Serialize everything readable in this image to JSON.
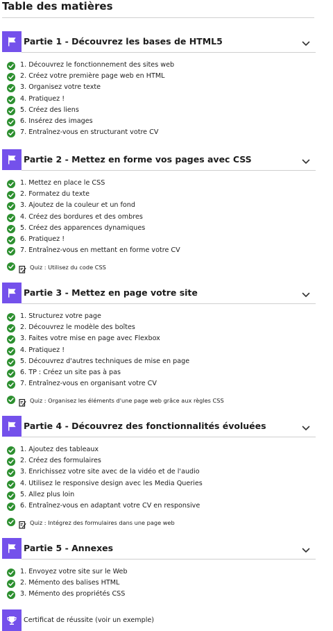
{
  "toc": {
    "title": "Table des matières"
  },
  "parts": [
    {
      "number": "Partie 1",
      "separator": " - ",
      "name": "Découvrez les bases de HTML5",
      "chapters": [
        "1. Découvrez le fonctionnement des sites web",
        "2. Créez votre première page web en HTML",
        "3. Organisez votre texte",
        "4. Pratiquez !",
        "5. Créez des liens",
        "6. Insérez des images",
        "7. Entraînez-vous en structurant votre CV"
      ],
      "quiz": null
    },
    {
      "number": "Partie 2",
      "separator": " - ",
      "name": "Mettez en forme vos pages avec CSS",
      "chapters": [
        "1. Mettez en place le CSS",
        "2. Formatez du texte",
        "3. Ajoutez de la couleur et un fond",
        "4. Créez des bordures et des ombres",
        "5. Créez des apparences dynamiques",
        "6. Pratiquez !",
        "7. Entraînez-vous en mettant en forme votre CV"
      ],
      "quiz": "Quiz : Utilisez du code CSS"
    },
    {
      "number": "Partie 3",
      "separator": " - ",
      "name": "Mettez en page votre site",
      "chapters": [
        "1. Structurez votre page",
        "2. Découvrez le modèle des boîtes",
        "3. Faites votre mise en page avec Flexbox",
        "4. Pratiquez !",
        "5. Découvrez d'autres techniques de mise en page",
        "6. TP : Créez un site pas à pas",
        "7. Entraînez-vous en organisant votre CV"
      ],
      "quiz": "Quiz : Organisez les éléments d'une page web grâce aux règles CSS"
    },
    {
      "number": "Partie 4",
      "separator": " - ",
      "name": "Découvrez des fonctionnalités évoluées",
      "chapters": [
        "1. Ajoutez des tableaux",
        "2. Créez des formulaires",
        "3. Enrichissez votre site avec de la vidéo et de l'audio",
        "4. Utilisez le responsive design avec les Media Queries",
        "5. Allez plus loin",
        "6. Entraînez-vous en adaptant votre CV en responsive"
      ],
      "quiz": "Quiz : Intégrez des formulaires dans une page web"
    },
    {
      "number": "Partie 5",
      "separator": " - ",
      "name": "Annexes",
      "chapters": [
        "1. Envoyez votre site sur le Web",
        "2. Mémento des balises HTML",
        "3. Mémento des propriétés CSS"
      ],
      "quiz": null
    }
  ],
  "certificate": {
    "label": "Certificat de réussite (voir un exemple)"
  },
  "icons": {
    "part": "flag-icon",
    "toggle": "chevron-down-icon",
    "done": "check-circle-icon",
    "quiz": "quiz-icon",
    "certificate": "trophy-icon"
  },
  "colors": {
    "accent": "#7451eb",
    "done": "#2c8f2f",
    "divider": "#cfcfcf",
    "text": "#1c1c1c"
  }
}
